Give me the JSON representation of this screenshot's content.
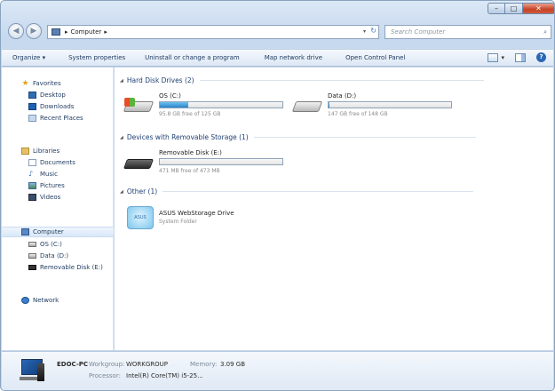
{
  "window": {
    "controls": {
      "minimize": "–",
      "maximize": "□",
      "close": "✕"
    }
  },
  "address_bar": {
    "back_glyph": "◀",
    "forward_glyph": "▶",
    "breadcrumb": [
      "▸",
      "Computer",
      "▸"
    ],
    "dropdown_glyph": "▾",
    "refresh_glyph": "↻"
  },
  "search": {
    "placeholder": "Search Computer",
    "icon": "search-icon",
    "glyph": "⌕"
  },
  "toolbar": {
    "organize": "Organize ▾",
    "system_properties": "System properties",
    "uninstall": "Uninstall or change a program",
    "map_drive": "Map network drive",
    "control_panel": "Open Control Panel",
    "views_arrow": "▾",
    "help": "?"
  },
  "nav_pane": {
    "favorites": "Favorites",
    "desktop": "Desktop",
    "downloads": "Downloads",
    "recent_places": "Recent Places",
    "libraries": "Libraries",
    "documents": "Documents",
    "music": "Music",
    "pictures": "Pictures",
    "videos": "Videos",
    "computer": "Computer",
    "os_c": "OS (C:)",
    "data_d": "Data (D:)",
    "removable": "Removable Disk (E:)",
    "network": "Network",
    "star_glyph": "★",
    "note_glyph": "♪"
  },
  "groups": {
    "hard_disk": "Hard Disk Drives (2)",
    "removable": "Devices with Removable Storage (1)",
    "other": "Other (1)",
    "collapse_glyph": "◢"
  },
  "drives": {
    "os": {
      "name": "OS (C:)",
      "free": "95.8 GB free of 125 GB",
      "used_fraction": 0.23
    },
    "data": {
      "name": "Data (D:)",
      "free": "147 GB free of 148 GB",
      "used_fraction": 0.01
    },
    "usb": {
      "name": "Removable Disk (E:)",
      "free": "471 MB free of 473 MB",
      "used_fraction": 0.0
    },
    "asus": {
      "name": "ASUS WebStorage Drive",
      "sub": "System Folder",
      "logo_text": "ASUS"
    }
  },
  "details": {
    "pc_name": "EDOC-PC",
    "workgroup_label": "Workgroup:",
    "workgroup_value": "WORKGROUP",
    "memory_label": "Memory:",
    "memory_value": "3.09 GB",
    "processor_label": "Processor:",
    "processor_value": "Intel(R) Core(TM) i5-25..."
  }
}
